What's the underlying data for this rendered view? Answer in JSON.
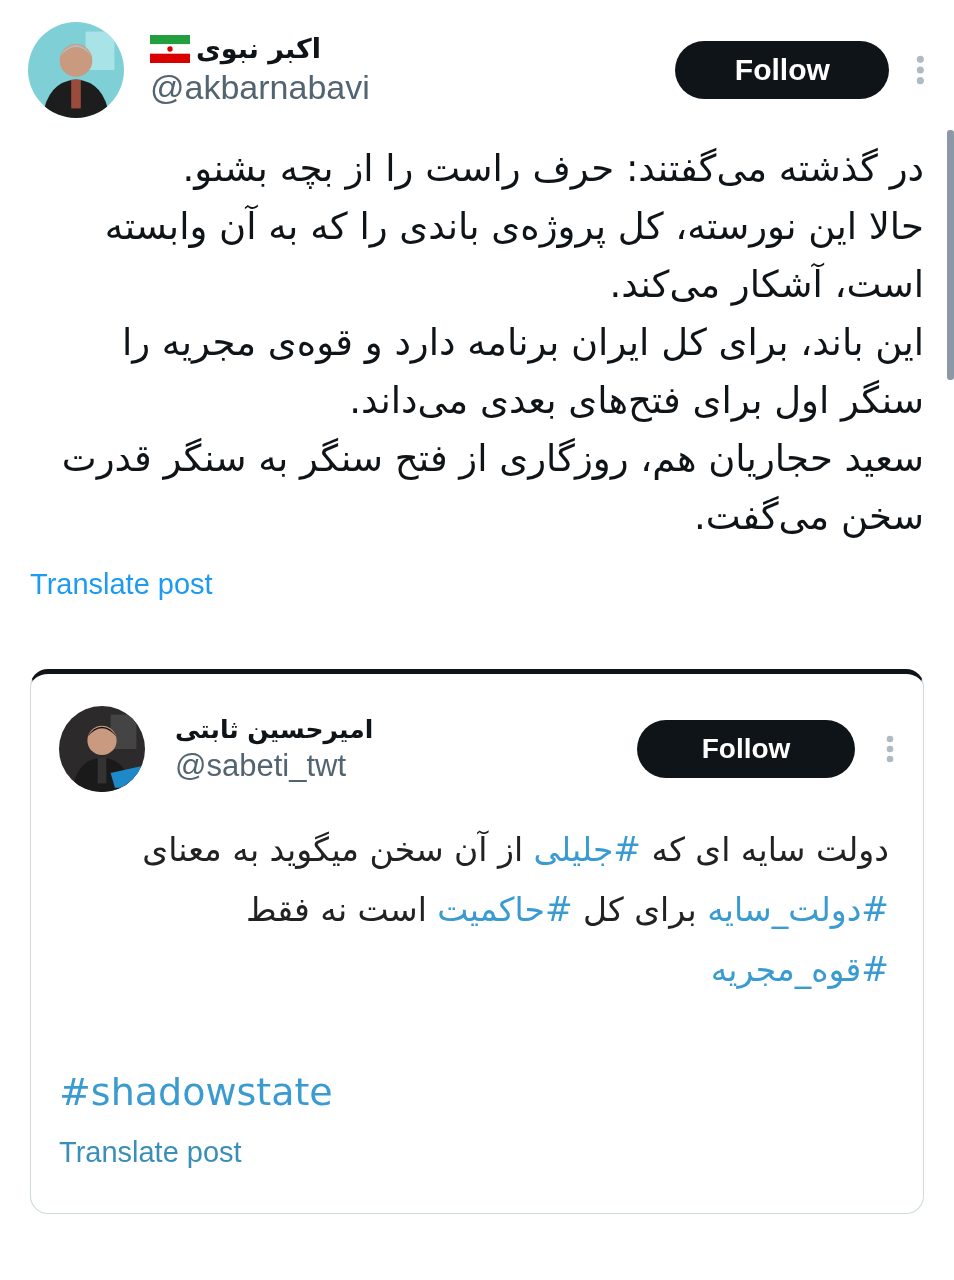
{
  "post": {
    "author": {
      "name": "اکبر نبوی",
      "handle": "@akbarnabavi"
    },
    "follow_button": "Follow",
    "paragraphs": [
      "در گذشته می‌گفتند: حرف راست را از بچه بشنو.",
      "حالا این نورسته، کل پروژه‌ی باندی را که به آن وابسته است، آشکار می‌کند.",
      "این باند، برای کل ایران برنامه دارد و قوه‌ی مجریه را سنگر اول برای فتح‌های بعدی می‌داند.",
      "سعید حجاریان هم، روزگاری از فتح سنگر به سنگر قدرت سخن می‌گفت."
    ],
    "translate_link": "Translate post"
  },
  "quoted_screenshot": {
    "author": {
      "name": "امیرحسین ثابتی",
      "handle": "@sabeti_twt"
    },
    "follow_button": "Follow",
    "body": [
      {
        "kind": "text",
        "text": "دولت سایه ای که "
      },
      {
        "kind": "hashtag",
        "text": "#جلیلی"
      },
      {
        "kind": "text",
        "text": " از آن سخن میگوید به معنای "
      },
      {
        "kind": "hashtag",
        "text": "#دولت_سایه"
      },
      {
        "kind": "text",
        "text": " برای کل "
      },
      {
        "kind": "hashtag",
        "text": "#حاکمیت"
      },
      {
        "kind": "text",
        "text": " است نه فقط "
      },
      {
        "kind": "hashtag",
        "text": "#قوه_مجریه"
      }
    ],
    "tag_line": "#shadowstate",
    "translate_link": "Translate post"
  }
}
